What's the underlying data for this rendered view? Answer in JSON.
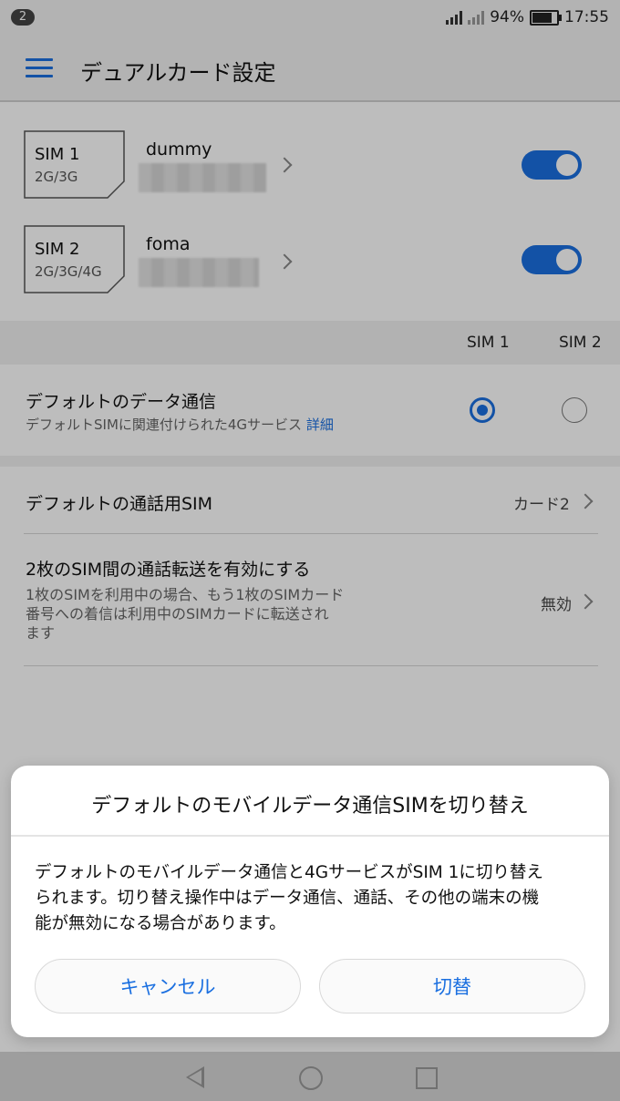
{
  "status_bar": {
    "notification_count": "2",
    "battery_percent": "94%",
    "time": "17:55",
    "icons": [
      "signal-icon",
      "no-signal-icon",
      "battery-icon"
    ]
  },
  "app_bar": {
    "title": "デュアルカード設定",
    "menu_icon": "hamburger-menu-icon",
    "accent_color": "#1a6fe0"
  },
  "sim_cards": [
    {
      "name": "SIM 1",
      "type": "2G/3G",
      "carrier": "dummy",
      "enabled": true
    },
    {
      "name": "SIM 2",
      "type": "2G/3G/4G",
      "carrier": "foma",
      "enabled": true
    }
  ],
  "sim_columns": [
    "SIM 1",
    "SIM 2"
  ],
  "default_data": {
    "title": "デフォルトのデータ通信",
    "subtitle": "デフォルトSIMに関連付けられた4Gサービス",
    "link": "詳細",
    "selected": "SIM 1"
  },
  "default_call": {
    "title": "デフォルトの通話用SIM",
    "value": "カード2"
  },
  "call_forward": {
    "title": "2枚のSIM間の通話転送を有効にする",
    "subtitle_line1": "1枚のSIMを利用中の場合、もう1枚のSIMカード",
    "subtitle_line2": "番号への着信は利用中のSIMカードに転送され",
    "subtitle_line3": "ます",
    "value": "無効"
  },
  "dialog": {
    "title": "デフォルトのモバイルデータ通信SIMを切り替え",
    "body_line1": "デフォルトのモバイルデータ通信と4GサービスがSIM 1に切り替え",
    "body_line2": "られます。切り替え操作中はデータ通信、通話、その他の端末の機",
    "body_line3": "能が無効になる場合があります。",
    "cancel_label": "キャンセル",
    "confirm_label": "切替"
  },
  "nav_bar": {
    "icons": [
      "back-icon",
      "home-icon",
      "recent-apps-icon"
    ]
  }
}
